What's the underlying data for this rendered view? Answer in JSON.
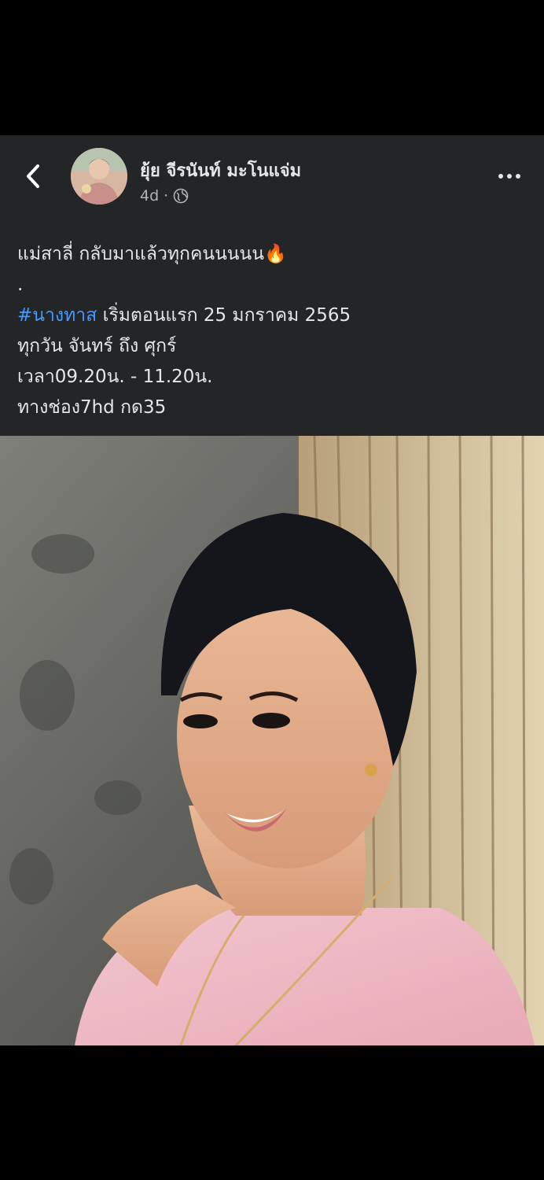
{
  "post": {
    "author": "ยุ้ย จีรนันท์ มะโนแจ่ม",
    "time": "4d",
    "separator": "·",
    "visibility_icon": "globe-icon",
    "caption_lines": [
      {
        "text": "แม่สาลี่ กลับมาแล้วทุกคนนนนน",
        "emoji": "🔥"
      },
      {
        "text": "."
      },
      {
        "hashtag": "#นางทาส",
        "text": " เริ่มตอนแรก 25 มกราคม 2565"
      },
      {
        "text": "ทุกวัน จันทร์ ถึง ศุกร์"
      },
      {
        "text": "เวลา09.20น. - 11.20น."
      },
      {
        "text": "ทางช่อง7hd กด35"
      }
    ]
  },
  "icons": {
    "back": "chevron-left-icon",
    "more": "more-horizontal-icon"
  },
  "colors": {
    "background": "#000000",
    "card": "#242526",
    "text": "#e4e6eb",
    "secondary": "#b0b3b8",
    "link": "#4599ff"
  }
}
